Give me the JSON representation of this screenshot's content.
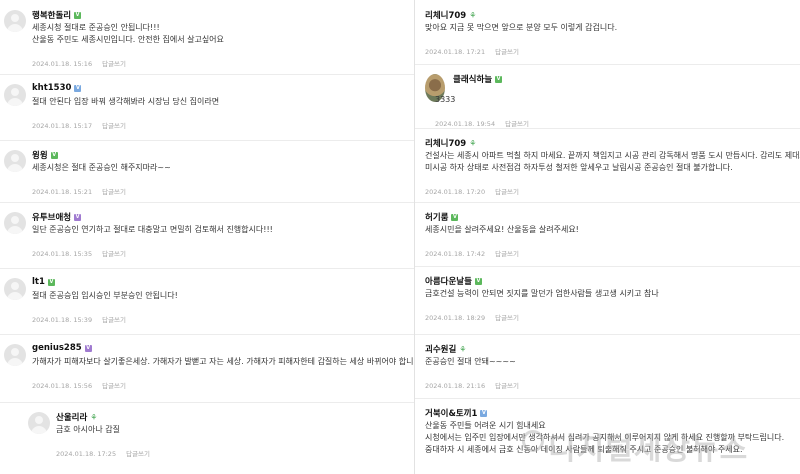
{
  "reply_label": "답글쓰기",
  "left_comments": [
    {
      "nick": "행복한돌리",
      "badge": "green",
      "lines": [
        "세종시청 절대로 준공승인 안됩니다!!!",
        "산울동 주민도 세종시민입니다. 안전한 집에서 살고싶어요"
      ],
      "date": "2024.01.18. 15:16"
    },
    {
      "nick": "kht1530",
      "badge": "blue",
      "lines": [
        "절대 안된다 입장 바꿔 생각해봐라 시장님 당신 집이라면"
      ],
      "date": "2024.01.18. 15:17"
    },
    {
      "nick": "윙윙",
      "badge": "green",
      "lines": [
        "세종시청은 절대 준공승인 해주지마라~~"
      ],
      "date": "2024.01.18. 15:21"
    },
    {
      "nick": "유투브애청",
      "badge": "purple",
      "lines": [
        "일단 준공승인 연기하고 절대로 대충말고 면밀히 검토해서 진행합시다!!!"
      ],
      "date": "2024.01.18. 15:35"
    },
    {
      "nick": "lt1",
      "badge": "green",
      "lines": [
        "절대 준공승임 임시승인 부분승인 안됩니다!"
      ],
      "date": "2024.01.18. 15:39"
    },
    {
      "nick": "genius285",
      "badge": "purple",
      "lines": [
        "가해자가 피해자보다 살기좋은세상. 가해자가 발뻗고 자는 세상. 가해자가 피해자한테 갑질하는 세상 바뀌어야 합니다"
      ],
      "date": "2024.01.18. 15:56"
    },
    {
      "nick": "산울리라",
      "badge": "leaf",
      "lines": [
        "금호 아시아나 갑질"
      ],
      "date": "2024.01.18. 17:25"
    }
  ],
  "right_comments": [
    {
      "nick": "리체니709",
      "badge": "leaf",
      "lines": [
        "맞아요 지금 못 막으면 앞으로 분양 모두 이렇게 갑겁니다."
      ],
      "date": "2024.01.18. 17:21"
    },
    {
      "nick": "클래식하늘",
      "badge": "green",
      "lines": [
        "3333"
      ],
      "date": "2024.01.18. 19:54"
    },
    {
      "nick": "리체니709",
      "badge": "leaf",
      "lines": [
        "건설사는 세종시 아파트 먹칠 하지 마세요. 끝까지 책임지고 시공 관리 감독해서 명품 도시 만듭시다. 감리도 제대로 안하고",
        "미시공 하자 상태로 사전점검 하자투성 철저한 앞세우고 날림시공 준공승인 절대 불가합니다."
      ],
      "date": "2024.01.18. 17:20"
    },
    {
      "nick": "허기룸",
      "badge": "green",
      "lines": [
        "세종시민을 살려주세요! 산울동을 살려주세요!"
      ],
      "date": "2024.01.18. 17:42"
    },
    {
      "nick": "아름다운날들",
      "badge": "green",
      "lines": [
        "금호건설 능력이 안되면 짓지를 말던가 엄한사람들 생고생 시키고 참나"
      ],
      "date": "2024.01.18. 18:29"
    },
    {
      "nick": "괴수원길",
      "badge": "leaf",
      "lines": [
        "준공승인 절대 안돼~~~~"
      ],
      "date": "2024.01.18. 21:16"
    },
    {
      "nick": "거북이&토끼1",
      "badge": "blue",
      "lines": [
        "산울동 주민들 어려운 시기 힘내세요",
        "시청에서는 입주민 입장에서만 생각하셔서 심려가 공지해서 이루어지지 않게 하세요 진행할까 부탁드립니다.",
        "중대하자 시 세종에서 금호 신동아 데이징 사람들께 퇴출해줘 주시고 준공승인 불허해야 주세요."
      ],
      "date": ""
    }
  ],
  "watermark": "디지털세상뉴스",
  "colors": {
    "nick": "#111111",
    "text": "#333333",
    "meta": "#a5a5a5",
    "divider": "#ececec",
    "badge_green": "#5cb85c",
    "badge_purple": "#a07bd0",
    "badge_blue": "#7aa9e0"
  }
}
